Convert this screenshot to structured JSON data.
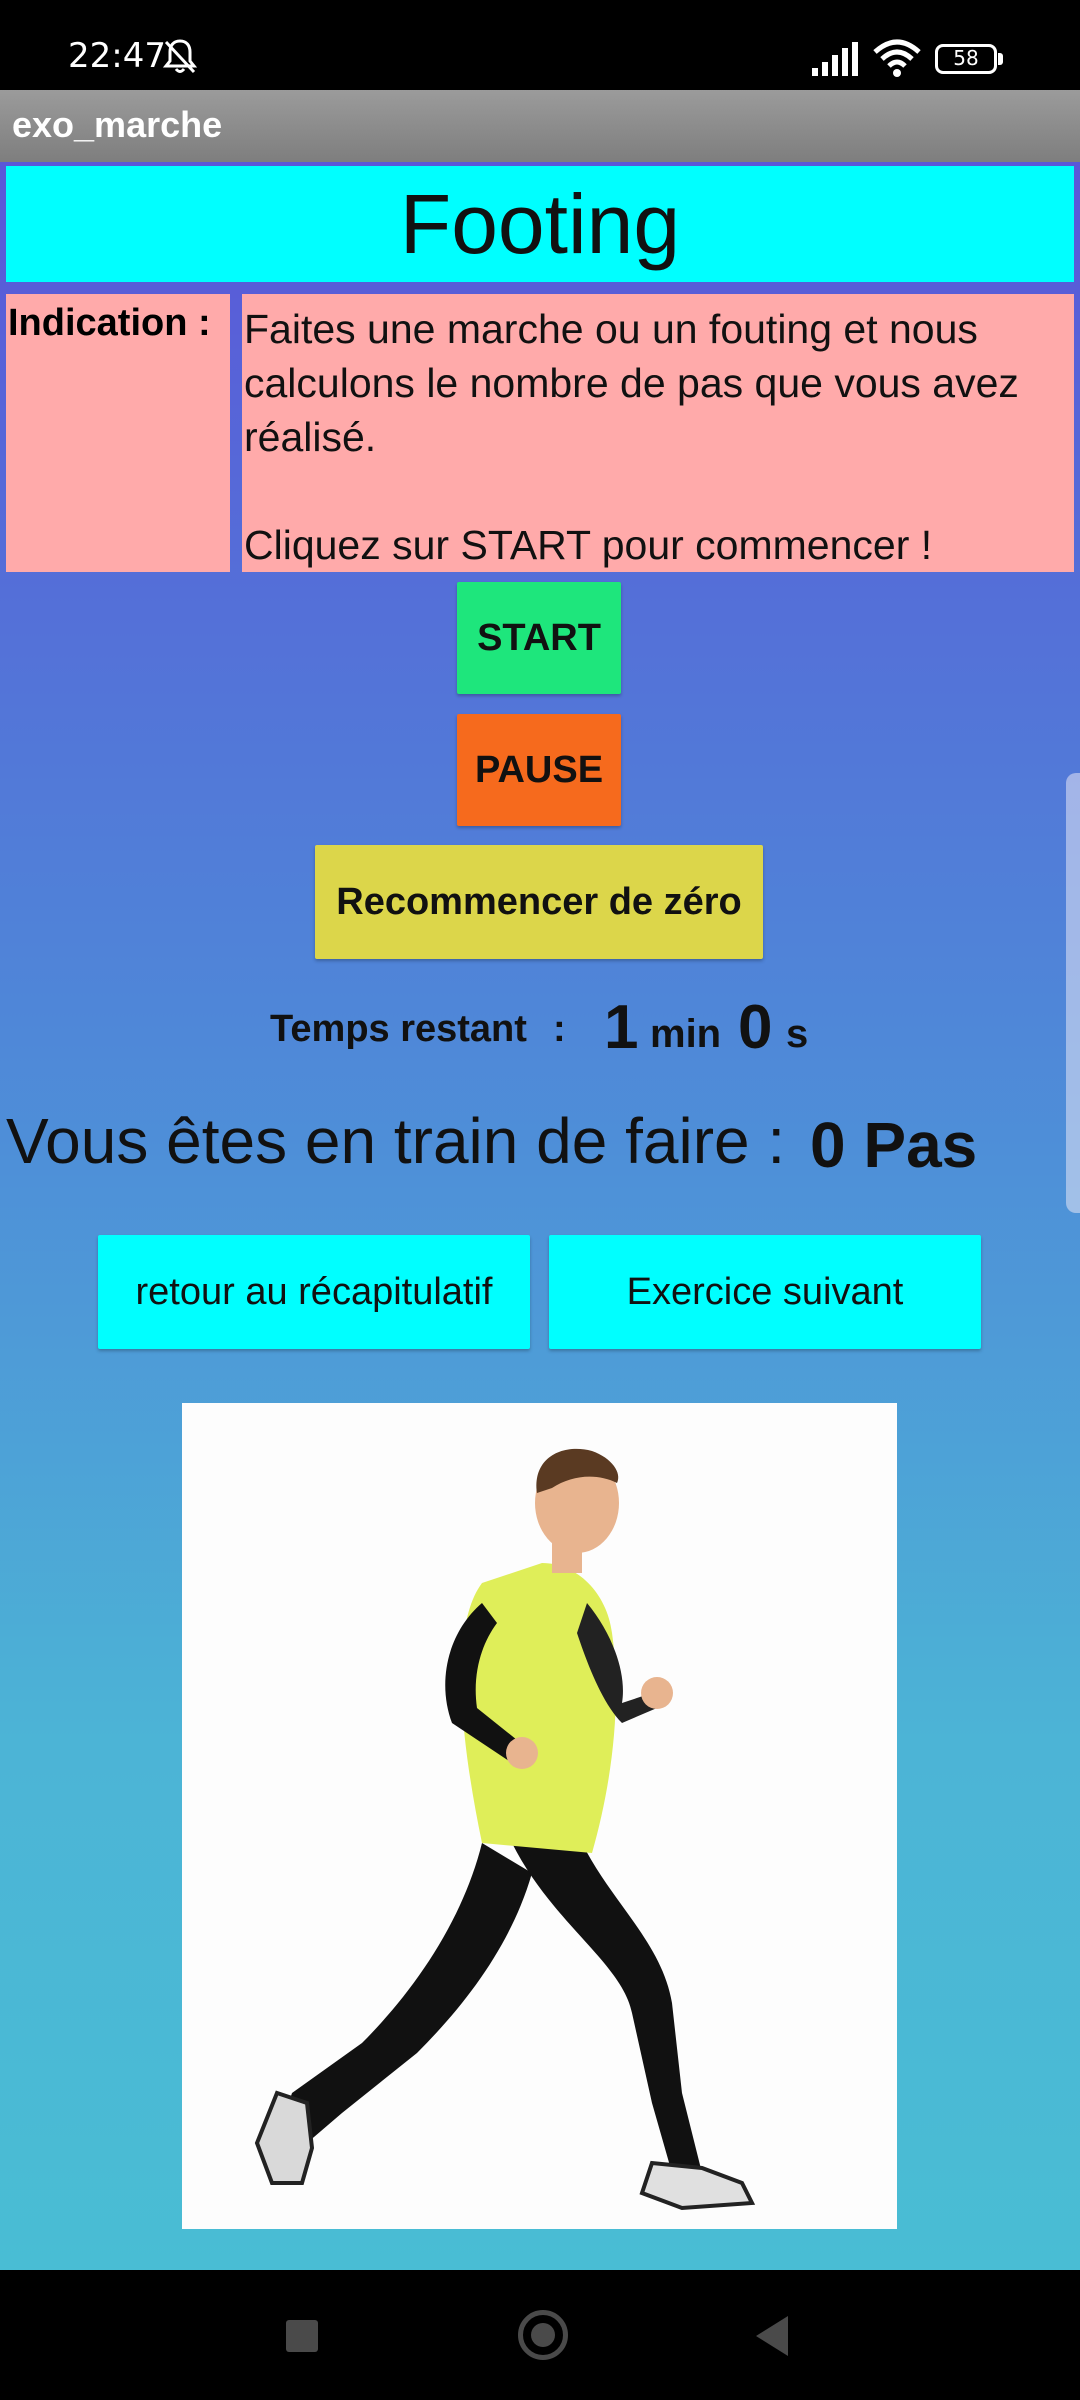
{
  "status_bar": {
    "time": "22:47",
    "battery": "58",
    "icons": [
      "bell-muted-icon",
      "signal-icon",
      "wifi-icon",
      "battery-icon"
    ]
  },
  "app": {
    "title": "exo_marche"
  },
  "header": {
    "title": "Footing"
  },
  "indication": {
    "label": "Indication :",
    "text": "Faites une marche ou un fouting et nous calculons le nombre de pas que vous avez réalisé.\n\nCliquez sur START pour commencer !"
  },
  "controls": {
    "start_label": "START",
    "pause_label": "PAUSE",
    "reset_label": "Recommencer de zéro"
  },
  "timer": {
    "label": "Temps restant",
    "separator": ":",
    "minutes": "1",
    "minutes_unit": "min",
    "seconds": "0",
    "seconds_unit": "s"
  },
  "steps": {
    "label": "Vous êtes en train de faire :",
    "value": "0 Pas"
  },
  "navigation": {
    "recap_label": "retour au récapitulatif",
    "next_label": "Exercice suivant"
  },
  "colors": {
    "header_bg": "#00ffff",
    "indication_bg": "#ffaaaa",
    "start_bg": "#1ee67c",
    "pause_bg": "#f66a1d",
    "reset_bg": "#dcd64a",
    "gradient_top": "#5a57d8",
    "gradient_bottom": "#49bdd4"
  }
}
